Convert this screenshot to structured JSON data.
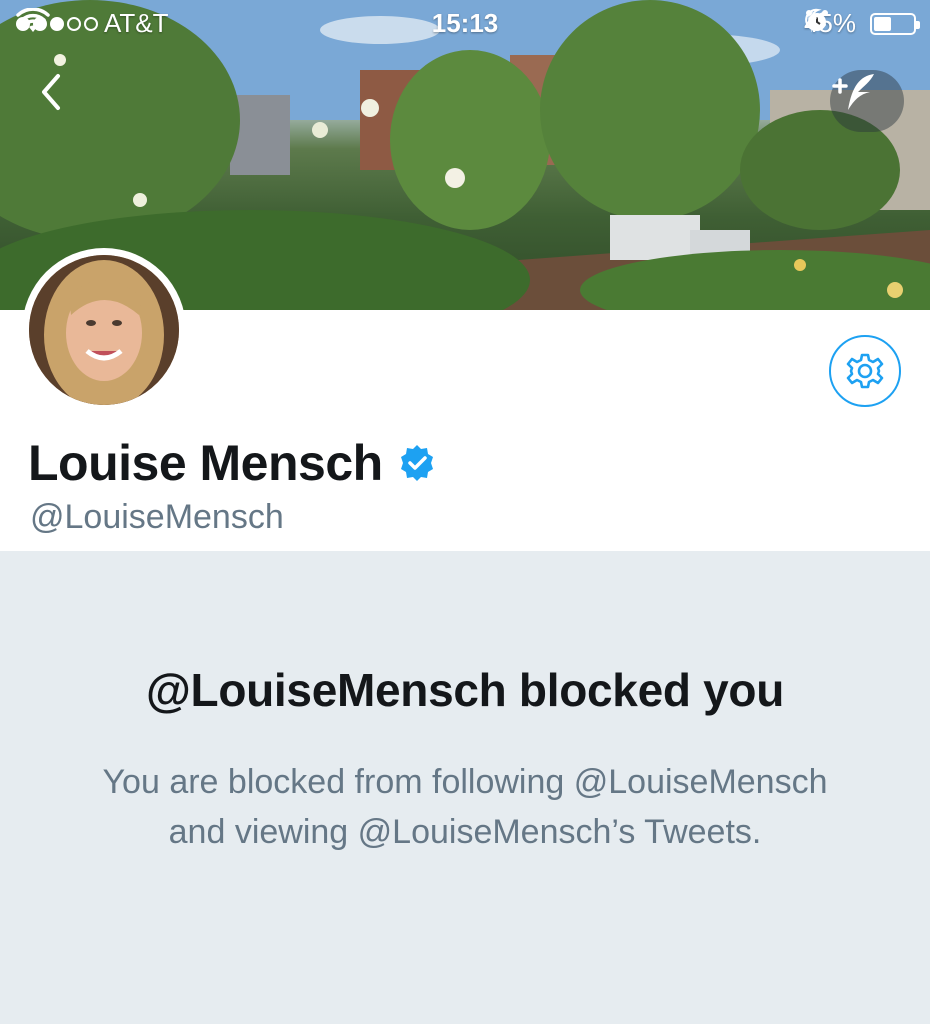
{
  "status_bar": {
    "carrier": "AT&T",
    "time": "15:13",
    "battery_percent": "45%",
    "battery_level": 0.45,
    "signal_bars_filled": 3,
    "signal_bars_total": 5
  },
  "header": {
    "back_icon": "chevron-left-icon",
    "compose_icon": "feather-plus-icon"
  },
  "profile": {
    "display_name": "Louise Mensch",
    "handle": "@LouiseMensch",
    "verified": true,
    "settings_icon": "gear-icon"
  },
  "blocked": {
    "title": "@LouiseMensch blocked you",
    "description_line1": "You are blocked from following @LouiseMensch",
    "description_line2": "and viewing @LouiseMensch’s Tweets."
  },
  "colors": {
    "accent": "#1da1f2",
    "text_primary": "#14171a",
    "text_secondary": "#657786",
    "panel_bg": "#e6ecf0"
  }
}
